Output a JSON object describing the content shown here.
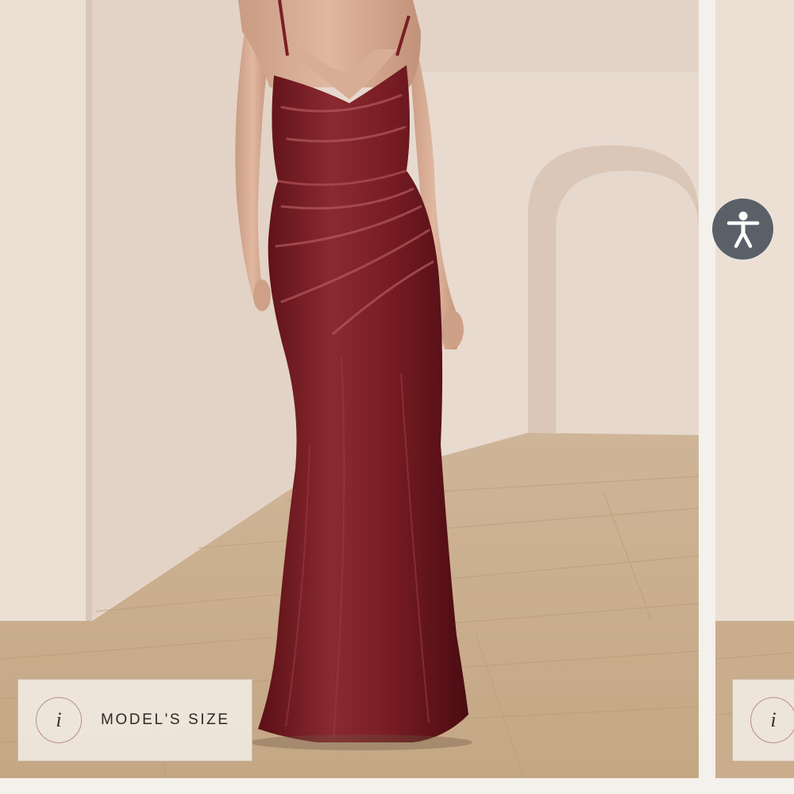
{
  "product_gallery": {
    "main_image_alt": "Model wearing a floor-length burgundy velvet gown with ruched bodice",
    "model_size_label": "MODEL'S SIZE",
    "info_glyph": "i"
  },
  "accessibility_widget": {
    "icon": "accessibility-person-icon"
  },
  "colors": {
    "dress": "#7a1e24",
    "wall": "#e4d6ca",
    "floor": "#c9ad8c",
    "badge_bg": "#f0e8e0",
    "a11y_bg": "#596068"
  }
}
